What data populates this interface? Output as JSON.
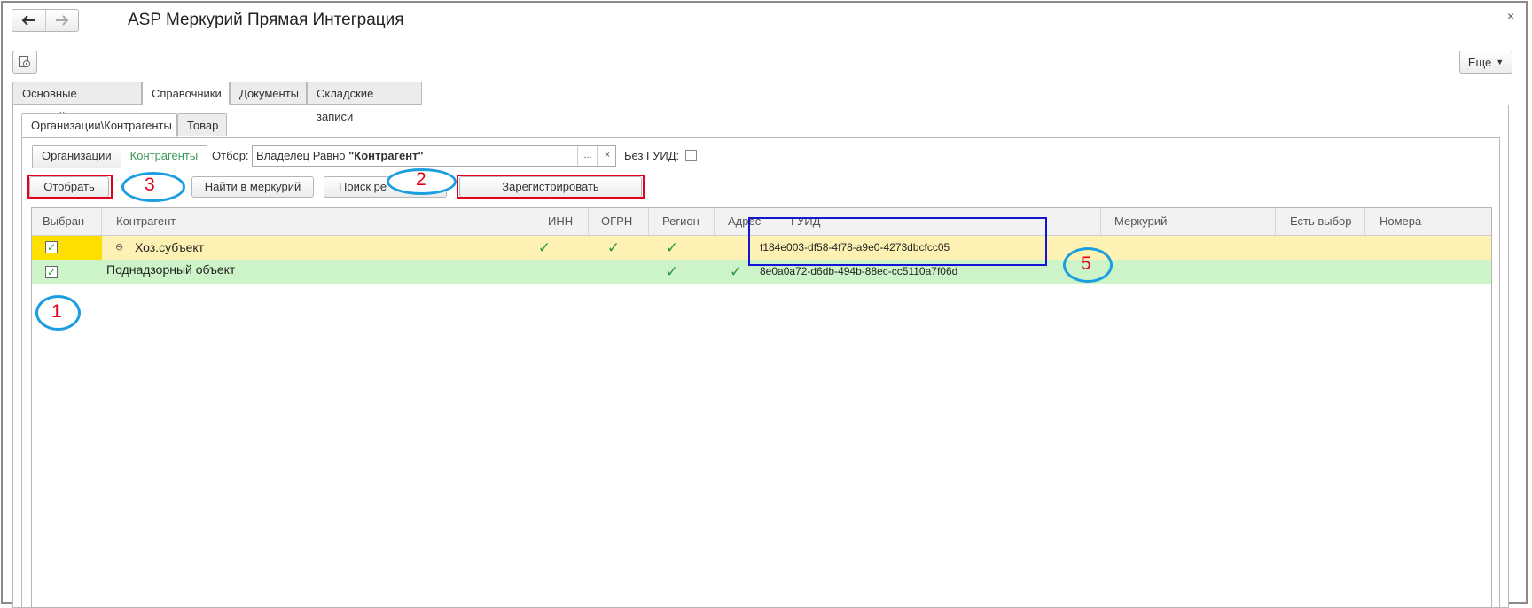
{
  "window": {
    "title": "ASP Меркурий Прямая Интеграция",
    "close": "×",
    "more_label": "Еще"
  },
  "icons": {
    "back": "back-arrow-icon",
    "forward": "forward-arrow-icon",
    "settings": "settings-icon",
    "close": "close-icon"
  },
  "tabs_main": [
    {
      "label": "Основные настройки",
      "active": false
    },
    {
      "label": "Справочники",
      "active": true
    },
    {
      "label": "Документы",
      "active": false
    },
    {
      "label": "Складские записи",
      "active": false
    }
  ],
  "tabs_sub": [
    {
      "label": "Организации\\Контрагенты",
      "active": true
    },
    {
      "label": "Товар",
      "active": false
    }
  ],
  "filter": {
    "seg_org": "Организации",
    "seg_contr": "Контрагенты",
    "label": "Отбор:",
    "value_prefix": "Владелец Равно ",
    "value_bold": "\"Контрагент\"",
    "select_btn": "...",
    "clear_btn": "×",
    "no_guid_label": "Без ГУИД:"
  },
  "actions": {
    "select": "Отобрать",
    "find": "Найти в меркурий",
    "search": "Поиск ре",
    "register": "Зарегистрировать"
  },
  "annotations": {
    "n1": "1",
    "n2": "2",
    "n3": "3",
    "n5": "5"
  },
  "table": {
    "columns": [
      "Выбран",
      "Контрагент",
      "ИНН",
      "ОГРН",
      "Регион",
      "Адрес",
      "ГУИД",
      "Меркурий",
      "Есть выбор",
      "Номера"
    ],
    "rows": [
      {
        "selected": true,
        "name": "Хоз.субъект",
        "inn": true,
        "ogrn": true,
        "region": true,
        "address": false,
        "guid": "f184e003-df58-4f78-a9e0-4273dbcfcc05",
        "color": "#fdf2b3",
        "select_color": "#fde000"
      },
      {
        "selected": true,
        "name": "Поднадзорный объект",
        "inn": false,
        "ogrn": false,
        "region": true,
        "address": true,
        "guid": "8e0a0a72-d6db-494b-88ec-cc5110a7f06d",
        "color": "#cdf4c8",
        "select_color": "#cdf4c8"
      }
    ],
    "tick": "✓",
    "collapse": "⊖"
  }
}
